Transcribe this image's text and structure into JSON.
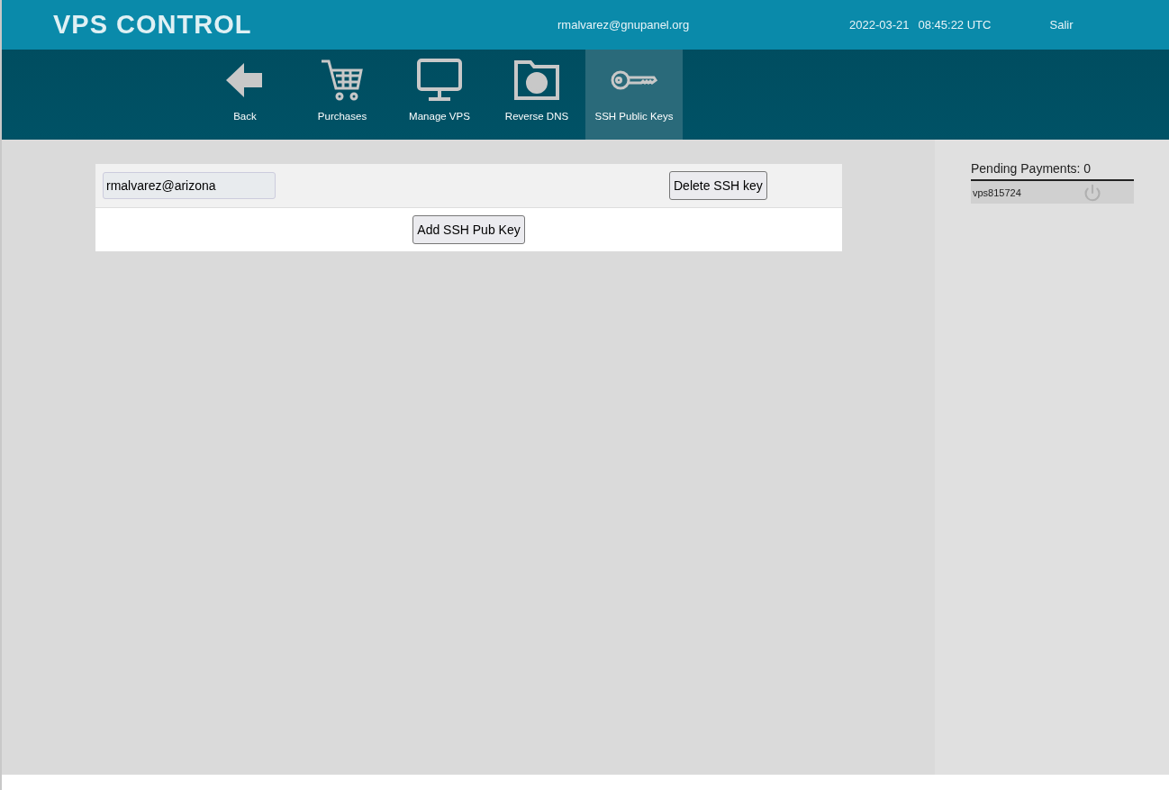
{
  "header": {
    "title": "VPS CONTROL",
    "user": "rmalvarez@gnupanel.org",
    "date": "2022-03-21",
    "time": "08:45:22 UTC",
    "logout": "Salir"
  },
  "nav": [
    {
      "kind": "back",
      "label": "Back",
      "selected": false
    },
    {
      "kind": "cart",
      "label": "Purchases",
      "selected": false
    },
    {
      "kind": "monitor",
      "label": "Manage VPS",
      "selected": false
    },
    {
      "kind": "globe",
      "label": "Reverse DNS",
      "selected": false
    },
    {
      "kind": "key",
      "label": "SSH Public Keys",
      "selected": true
    }
  ],
  "keys": [
    {
      "value": "rmalvarez@arizona",
      "button": "Delete SSH key"
    }
  ],
  "add_button": "Add SSH Pub Key",
  "sidebar": {
    "title": "Pending Payments: 0",
    "items": [
      {
        "name": "vps815724",
        "on": false
      }
    ]
  }
}
